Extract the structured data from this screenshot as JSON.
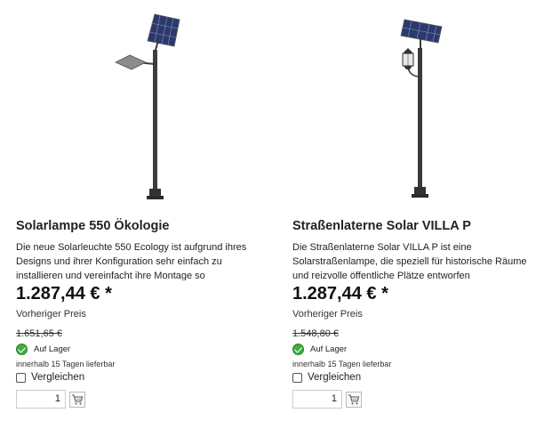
{
  "products": [
    {
      "title": "Solarlampe 550 Ökologie",
      "description": "Die neue Solarleuchte 550 Ecology ist aufgrund ihres Designs und ihrer Konfiguration sehr einfach zu installieren und vereinfacht ihre Montage so",
      "price": "1.287,44 € *",
      "previous_price_label": "Vorheriger Preis",
      "old_price": "1.651,65 €",
      "stock": "Auf Lager",
      "delivery": "innerhalb 15 Tagen lieferbar",
      "compare_label": "Vergleichen",
      "quantity": "1"
    },
    {
      "title": "Straßenlaterne Solar VILLA P",
      "description": "Die Straßenlaterne Solar VILLA P ist eine Solarstraßenlampe, die speziell für historische Räume und reizvolle öffentliche Plätze entworfen",
      "price": "1.287,44 € *",
      "previous_price_label": "Vorheriger Preis",
      "old_price": "1.548,80 €",
      "stock": "Auf Lager",
      "delivery": "innerhalb 15 Tagen lieferbar",
      "compare_label": "Vergleichen",
      "quantity": "1"
    }
  ],
  "icons": {
    "stock": "check-circle-icon",
    "cart": "shopping-cart-icon"
  },
  "colors": {
    "stock_green": "#3fae3f",
    "text": "#222222"
  }
}
